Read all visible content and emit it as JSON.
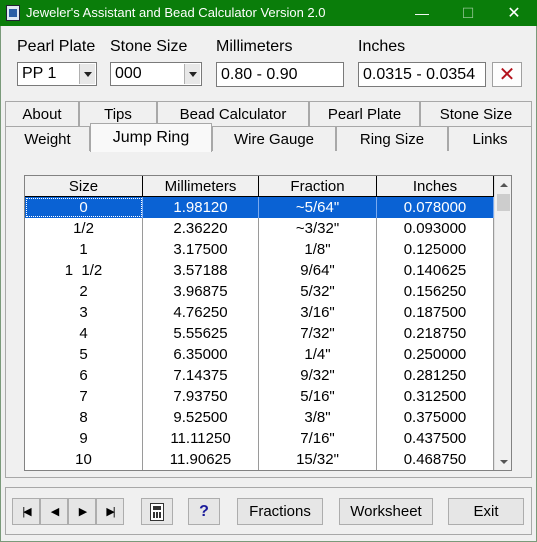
{
  "window": {
    "title": "Jeweler's Assistant and Bead Calculator Version 2.0",
    "min_glyph": "—",
    "max_glyph": "☐",
    "close_glyph": "✕"
  },
  "fields": {
    "pearl_plate_label": "Pearl Plate",
    "pearl_plate_value": "PP   1",
    "stone_size_label": "Stone Size",
    "stone_size_value": "000",
    "millimeters_label": "Millimeters",
    "millimeters_value": "0.80 - 0.90",
    "inches_label": "Inches",
    "inches_value": "0.0315 - 0.0354",
    "clear_glyph": "✕"
  },
  "tabs_row1": [
    "About",
    "Tips",
    "Bead Calculator",
    "Pearl Plate",
    "Stone Size"
  ],
  "tabs_row2": [
    "Weight",
    "Jump Ring",
    "Wire Gauge",
    "Ring Size",
    "Links"
  ],
  "active_tab": "Jump Ring",
  "table": {
    "columns": [
      "Size",
      "Millimeters",
      "Fraction",
      "Inches"
    ],
    "rows": [
      [
        "0",
        "1.98120",
        "~5/64\"",
        "0.078000"
      ],
      [
        "1/2",
        "2.36220",
        "~3/32\"",
        "0.093000"
      ],
      [
        "1",
        "3.17500",
        "1/8\"",
        "0.125000"
      ],
      [
        "1  1/2",
        "3.57188",
        "9/64\"",
        "0.140625"
      ],
      [
        "2",
        "3.96875",
        "5/32\"",
        "0.156250"
      ],
      [
        "3",
        "4.76250",
        "3/16\"",
        "0.187500"
      ],
      [
        "4",
        "5.55625",
        "7/32\"",
        "0.218750"
      ],
      [
        "5",
        "6.35000",
        "1/4\"",
        "0.250000"
      ],
      [
        "6",
        "7.14375",
        "9/32\"",
        "0.281250"
      ],
      [
        "7",
        "7.93750",
        "5/16\"",
        "0.312500"
      ],
      [
        "8",
        "9.52500",
        "3/8\"",
        "0.375000"
      ],
      [
        "9",
        "11.11250",
        "7/16\"",
        "0.437500"
      ],
      [
        "10",
        "11.90625",
        "15/32\"",
        "0.468750"
      ]
    ],
    "selected_row": 0
  },
  "buttons": {
    "first_glyph": "|◀",
    "prev_glyph": "◀",
    "next_glyph": "▶",
    "last_glyph": "▶|",
    "help_label": "?",
    "fractions_label": "Fractions",
    "worksheet_label": "Worksheet",
    "exit_label": "Exit"
  },
  "colors": {
    "titlebar": "#0a7d0a",
    "selection": "#0a62d4",
    "clear_x": "#b3121c"
  }
}
